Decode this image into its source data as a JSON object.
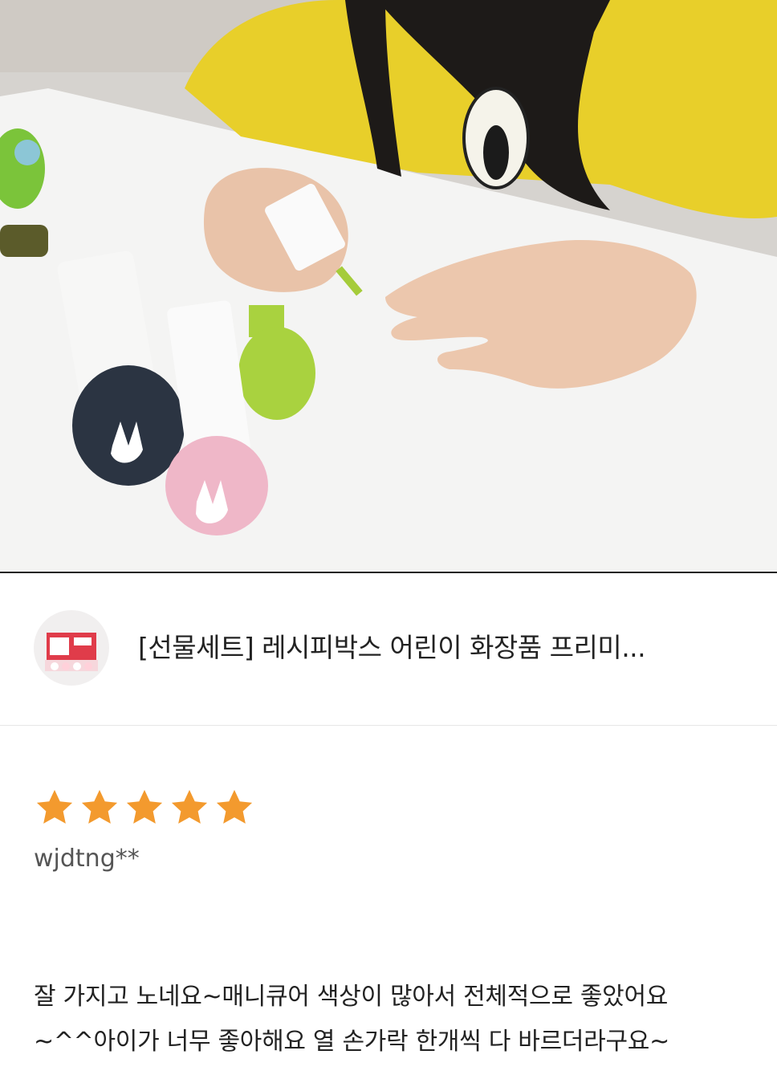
{
  "product": {
    "title": "[선물세트] 레시피박스 어린이 화장품 프리미...",
    "thumbnail_icon": "gift-set-thumbnail"
  },
  "photo": {
    "description_icon": "child-painting-nails-photo"
  },
  "review": {
    "rating": 5,
    "rating_max": 5,
    "star_color": "#f39a2e",
    "username": "wjdtng**",
    "lines": [
      "잘 가지고 노네요~매니큐어 색상이 많아서 전체적으로 좋았어요",
      "~^^아이가 너무 좋아해요 열 손가락 한개씩 다 바르더라구요~"
    ]
  }
}
